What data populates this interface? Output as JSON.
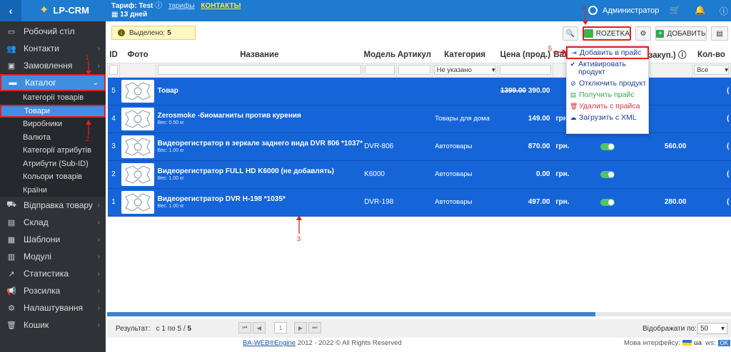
{
  "topbar": {
    "logo": "LP-CRM",
    "tariff_label": "Тариф:",
    "tariff_name": "Test",
    "tariff_days": "13 дней",
    "tariffs_link": "тарифы",
    "contacts_link": "КОНТАКТЫ",
    "user": "Администратор"
  },
  "sidebar": {
    "items": [
      {
        "label": "Робочий стіл",
        "icon": "desktop-icon"
      },
      {
        "label": "Контакти",
        "icon": "users-icon"
      },
      {
        "label": "Замовлення",
        "icon": "orders-icon"
      },
      {
        "label": "Каталог",
        "icon": "catalog-icon"
      }
    ],
    "subitems": [
      "Категорії товарів",
      "Товари",
      "Виробники",
      "Валюта",
      "Категорії атрибутів",
      "Атрибути (Sub-ID)",
      "Кольори товарів",
      "Країни"
    ],
    "items2": [
      {
        "label": "Відправка товару",
        "icon": "truck-icon"
      },
      {
        "label": "Склад",
        "icon": "warehouse-icon"
      },
      {
        "label": "Шаблони",
        "icon": "templates-icon"
      },
      {
        "label": "Модулі",
        "icon": "modules-icon"
      },
      {
        "label": "Статистика",
        "icon": "stats-icon"
      },
      {
        "label": "Розсилка",
        "icon": "mailing-icon"
      },
      {
        "label": "Налаштування",
        "icon": "gear-icon"
      },
      {
        "label": "Кошик",
        "icon": "trash-icon"
      }
    ]
  },
  "toolbar": {
    "selected_label": "Выделено:",
    "selected_count": "5",
    "rozetka_label": "ROZETKA",
    "add_label": "ДОБАВИТЬ"
  },
  "table": {
    "headers": {
      "id": "ID",
      "photo": "Фото",
      "name": "Название",
      "model": "Модель",
      "article": "Артикул",
      "category": "Категория",
      "price": "Цена (прод.)",
      "currency": "Валюта",
      "buy_price": "закуп.)",
      "qty": "Кол-во"
    },
    "filter_category": "Не указано",
    "filter_qty": "Все",
    "rows": [
      {
        "id": "5",
        "name": "Товар",
        "weight": "",
        "model": "",
        "category": "",
        "price_old": "1399.00",
        "price": "390.00",
        "currency": "",
        "buy": ""
      },
      {
        "id": "4",
        "name": "Zerosmoke -биомагниты против курения",
        "weight": "Вес: 0.50 кг",
        "model": "",
        "category": "Товары для дома",
        "price_old": "",
        "price": "149.00",
        "currency": "грн.",
        "buy": ""
      },
      {
        "id": "3",
        "name": "Видеорегистратор в зеркале заднего вида DVR 806 *1037*",
        "weight": "Вес: 1.00 кг",
        "model": "DVR-806",
        "category": "Автотовары",
        "price_old": "",
        "price": "870.00",
        "currency": "грн.",
        "buy": "560.00"
      },
      {
        "id": "2",
        "name": "Видеорегистратор FULL HD K6000 (не добавлять)",
        "weight": "Вес: 1.00 кг",
        "model": "K6000",
        "category": "Автотовары",
        "price_old": "",
        "price": "0.00",
        "currency": "грн.",
        "buy": ""
      },
      {
        "id": "1",
        "name": "Видеорегистратор DVR H-198 *1035*",
        "weight": "Вес: 1.00 кг",
        "model": "DVR-198",
        "category": "Автотовары",
        "price_old": "",
        "price": "497.00",
        "currency": "грн.",
        "buy": "280.00"
      }
    ]
  },
  "dropdown": {
    "items": [
      {
        "label": "Добавить в прайс",
        "icon": "sign-in-icon"
      },
      {
        "label": "Активировать продукт",
        "icon": "check-circle-icon"
      },
      {
        "label": "Отключить продукт",
        "icon": "ban-icon"
      },
      {
        "label": "Получить прайс",
        "icon": "file-excel-icon"
      },
      {
        "label": "Удалить с прайса",
        "icon": "trash-icon"
      },
      {
        "label": "Загрузить с XML",
        "icon": "cloud-upload-icon"
      }
    ]
  },
  "annotations": {
    "n1": "1",
    "n2": "2",
    "n3": "3",
    "n4": "4",
    "n5": "5"
  },
  "pager": {
    "result_label": "Результат:",
    "result_text": "с 1 по 5 /",
    "result_total": "5",
    "page": "1",
    "show_label": "Відображати по:",
    "per_page": "50"
  },
  "footer": {
    "copy_link": "BA-WEB®Engine",
    "copy_text": "2012 - 2022 © All Rights Reserved",
    "lang_label": "Мова інтерфейсу:",
    "lang": "ua",
    "ws": "ws:",
    "ok": "OK"
  }
}
